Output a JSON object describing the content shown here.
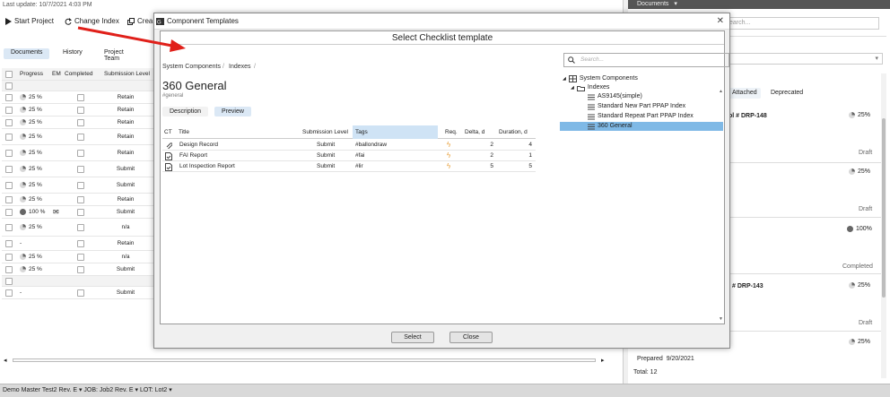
{
  "background": {
    "last_update": "Last update: 10/7/2021 4:03 PM",
    "toolbar": {
      "start_project": "Start Project",
      "change_index": "Change Index",
      "create_partial": "Crea"
    },
    "subtabs": [
      "Documents",
      "History",
      "Project Team"
    ],
    "grid": {
      "headers": [
        "Progress",
        "EM",
        "Completed",
        "Submission Level"
      ],
      "rows": [
        {
          "progress": "",
          "level": "",
          "empty": true
        },
        {
          "progress": "25 %",
          "level": "Retain"
        },
        {
          "progress": "25 %",
          "level": "Retain"
        },
        {
          "progress": "25 %",
          "level": "Retain"
        },
        {
          "progress": "25 %",
          "level": "Retain"
        },
        {
          "progress": "25 %",
          "level": "Retain"
        },
        {
          "progress": "25 %",
          "level": "Submit"
        },
        {
          "progress": "25 %",
          "level": "Submit"
        },
        {
          "progress": "25 %",
          "level": "Retain"
        },
        {
          "progress": "100 %",
          "level": "Submit",
          "full": true,
          "mail": true
        },
        {
          "progress": "25 %",
          "level": "n/a"
        },
        {
          "progress": "-",
          "level": "Retain"
        },
        {
          "progress": "25 %",
          "level": "n/a"
        },
        {
          "progress": "25 %",
          "level": "Submit"
        },
        {
          "progress": "",
          "level": "",
          "empty": true
        },
        {
          "progress": "-",
          "level": "Submit"
        }
      ]
    },
    "right_pane": {
      "header": "Documents",
      "search_placeholder": "earch...",
      "tabs": [
        "Attached",
        "Deprecated"
      ],
      "items": [
        {
          "title": "ol # DRP-148",
          "pct": "25%",
          "status": "Draft"
        },
        {
          "title": "",
          "pct": "25%",
          "status": "Draft"
        },
        {
          "title": "",
          "pct": "100%",
          "status": "Completed"
        },
        {
          "title": "# DRP-143",
          "pct": "25%",
          "status": "Draft"
        },
        {
          "title": "",
          "pct": "25%",
          "status": ""
        }
      ],
      "prepared_label": "Prepared",
      "prepared_date": "9/20/2021",
      "total": "Total: 12"
    },
    "statusbar": {
      "project": "Demo Master Test2 Rev. E",
      "job": "JOB: Job2 Rev. E",
      "lot": "LOT: Lot2"
    }
  },
  "modal": {
    "window_title": "Component Templates",
    "heading": "Select Checklist template",
    "breadcrumb": [
      "System Components",
      "Indexes"
    ],
    "template_title": "360 General",
    "template_tag": "#general",
    "tabs": [
      "Description",
      "Preview"
    ],
    "table": {
      "headers": [
        "CT",
        "Title",
        "Submission Level",
        "Tags",
        "Req.",
        "Delta, d",
        "Duration, d"
      ],
      "rows": [
        {
          "icon": "paperclip-icon",
          "title": "Design Record",
          "level": "Submit",
          "tag": "#ballondraw",
          "delta": "2",
          "duration": "4"
        },
        {
          "icon": "document-check-icon",
          "title": "FAI Report",
          "level": "Submit",
          "tag": "#fai",
          "delta": "2",
          "duration": "1"
        },
        {
          "icon": "document-check-icon",
          "title": "Lot Inspection Report",
          "level": "Submit",
          "tag": "#lir",
          "delta": "5",
          "duration": "5"
        }
      ]
    },
    "search_placeholder": "Search...",
    "tree": {
      "root": "System Components",
      "folder": "Indexes",
      "items": [
        "AS9145(simple)",
        "Standard New Part PPAP Index",
        "Standard Repeat Part PPAP Index",
        "360 General"
      ],
      "selected": "360 General"
    },
    "buttons": {
      "select": "Select",
      "close": "Close"
    }
  },
  "colors": {
    "selected_row": "#7fb9e6",
    "tags_header": "#cfe3f5",
    "active_tab": "#dbe8f5",
    "arrow": "#e0201a",
    "lightning": "#e8a03c"
  }
}
